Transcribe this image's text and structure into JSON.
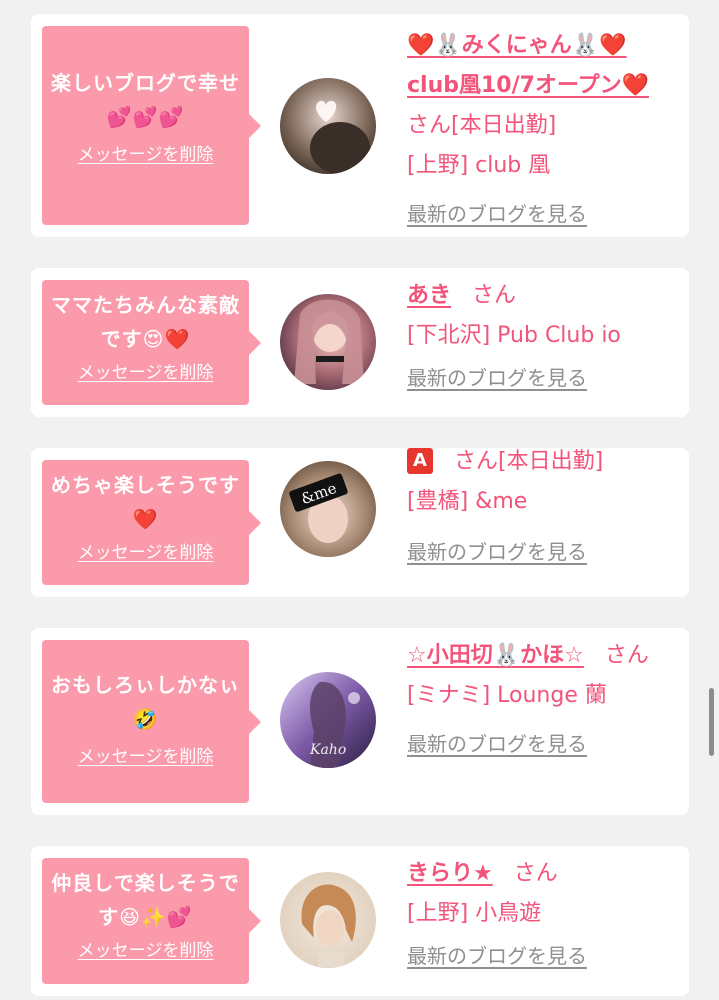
{
  "delete_label": "メッセージを削除",
  "blog_label": "最新のブログを見る",
  "colors": {
    "bubble": "#fa9aaa",
    "accent": "#f2547a",
    "link_gray": "#8f8f8f",
    "background": "#f1f1f1"
  },
  "items": [
    {
      "message": "楽しいブログで幸せ💕💕💕",
      "name": "❤️🐰みくにゃん🐰❤️club凰10/7オープン❤️",
      "san": "さん",
      "status": "[本日出勤]",
      "shop": "[上野] club 凰",
      "avatar_icon": "avatar-photo-icon"
    },
    {
      "message": "ママたちみんな素敵です😍❤️",
      "name": "あき",
      "san": "さん",
      "status": "",
      "shop": "[下北沢] Pub Club io",
      "avatar_icon": "avatar-photo-icon"
    },
    {
      "message": "めちゃ楽しそうです❤️",
      "name": "🅰️",
      "san": "さん",
      "status": "[本日出勤]",
      "shop": "[豊橋] &me",
      "avatar_icon": "avatar-photo-icon",
      "avatar_text": "&me"
    },
    {
      "message": "おもしろぃしかなぃ🤣",
      "name": "☆小田切🐰かほ☆",
      "san": "さん",
      "status": "",
      "shop": "[ミナミ] Lounge 蘭",
      "avatar_icon": "avatar-photo-icon"
    },
    {
      "message": "仲良しで楽しそうです😆✨💕",
      "name": "きらり★",
      "san": "さん",
      "status": "",
      "shop": "[上野] 小鳥遊",
      "avatar_icon": "avatar-photo-icon"
    }
  ]
}
